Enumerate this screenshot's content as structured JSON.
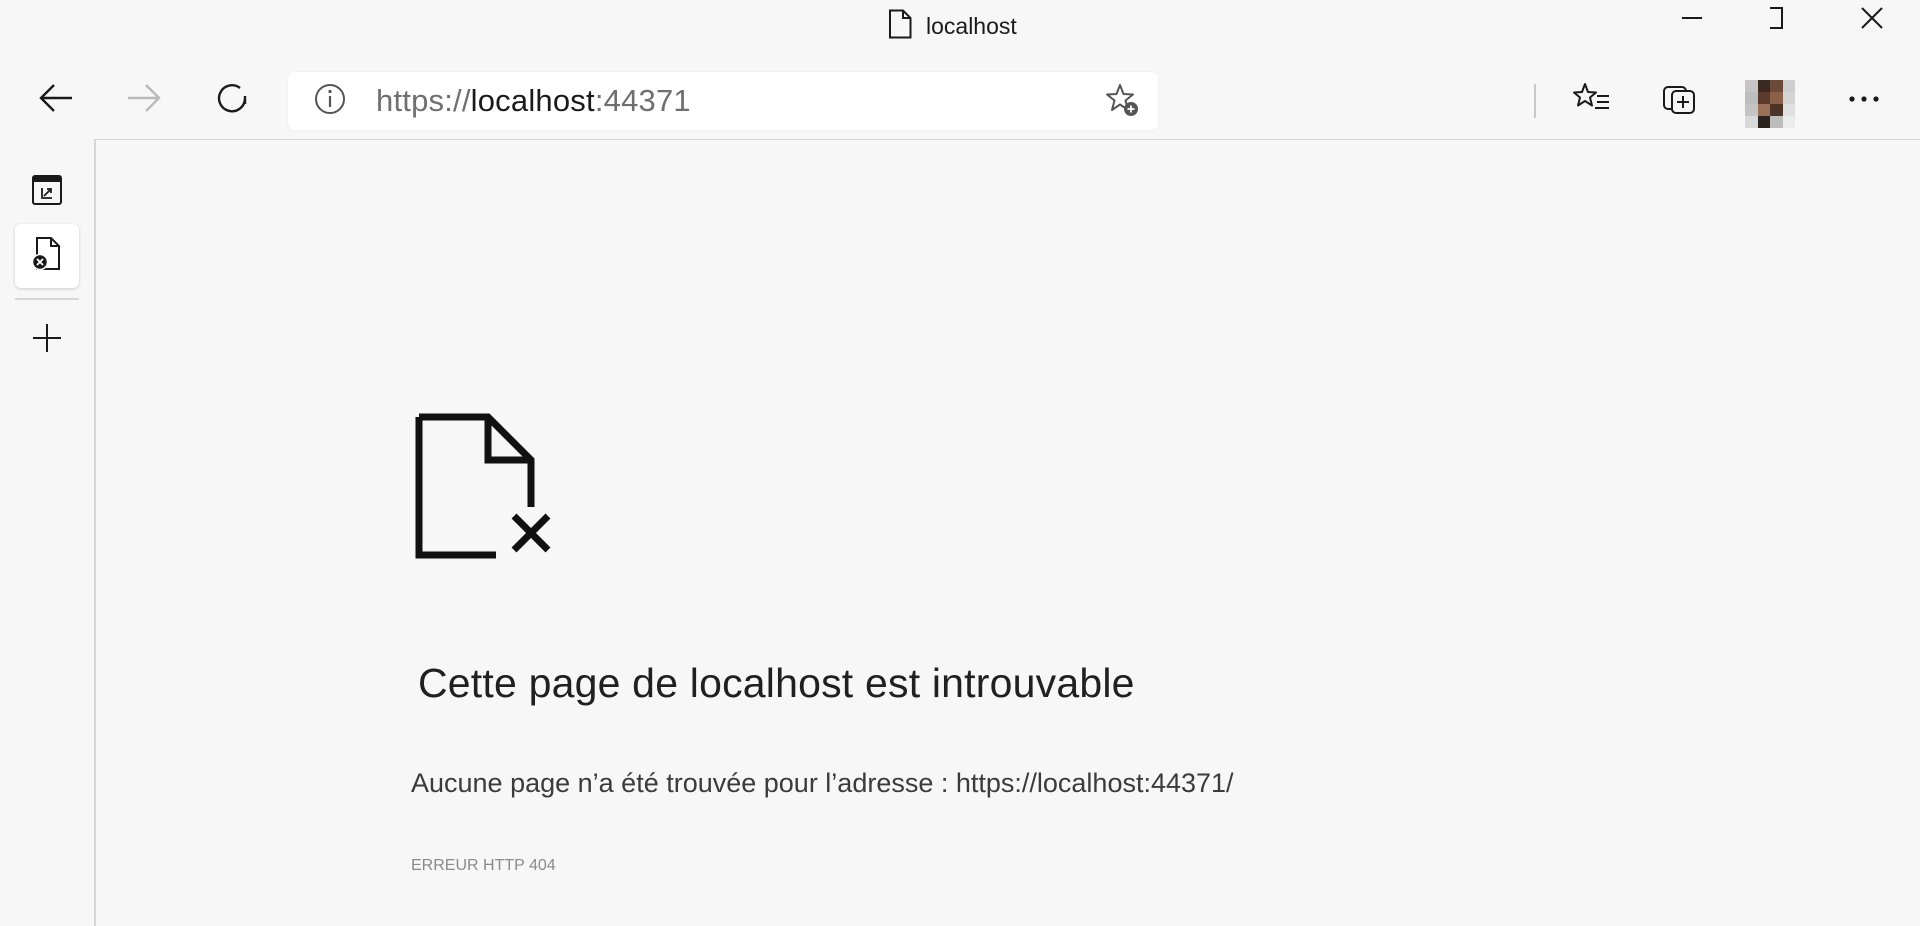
{
  "window": {
    "title": "localhost",
    "page_icon": "page-icon",
    "controls": [
      "minimize-icon",
      "maximize-icon",
      "close-icon"
    ]
  },
  "toolbar": {
    "back_icon": "back-arrow-icon",
    "forward_icon": "forward-arrow-icon",
    "refresh_icon": "refresh-icon",
    "favorites_icon": "favorites-list-icon",
    "collections_icon": "collections-icon",
    "profile_icon": "avatar",
    "more_icon": "more-icon"
  },
  "address": {
    "info_icon": "info-icon",
    "scheme": "https://",
    "host": "localhost",
    "port": ":44371",
    "add_favorite_icon": "add-favorite-icon"
  },
  "sidebar": {
    "items": [
      {
        "icon": "tab-actions-icon"
      },
      {
        "icon": "error-page-tab-icon",
        "active": true
      },
      {
        "icon": "new-tab-icon"
      }
    ]
  },
  "error": {
    "icon": "page-error-icon",
    "title": "Cette page de localhost est introuvable",
    "description": "Aucune page n’a été trouvée pour l’adresse : https://localhost:44371/",
    "code": "ERREUR HTTP 404"
  },
  "colors": {
    "background": "#f7f7f7",
    "address_bar": "#ffffff",
    "text": "#1a1a1a",
    "muted": "#6f6f6f"
  }
}
